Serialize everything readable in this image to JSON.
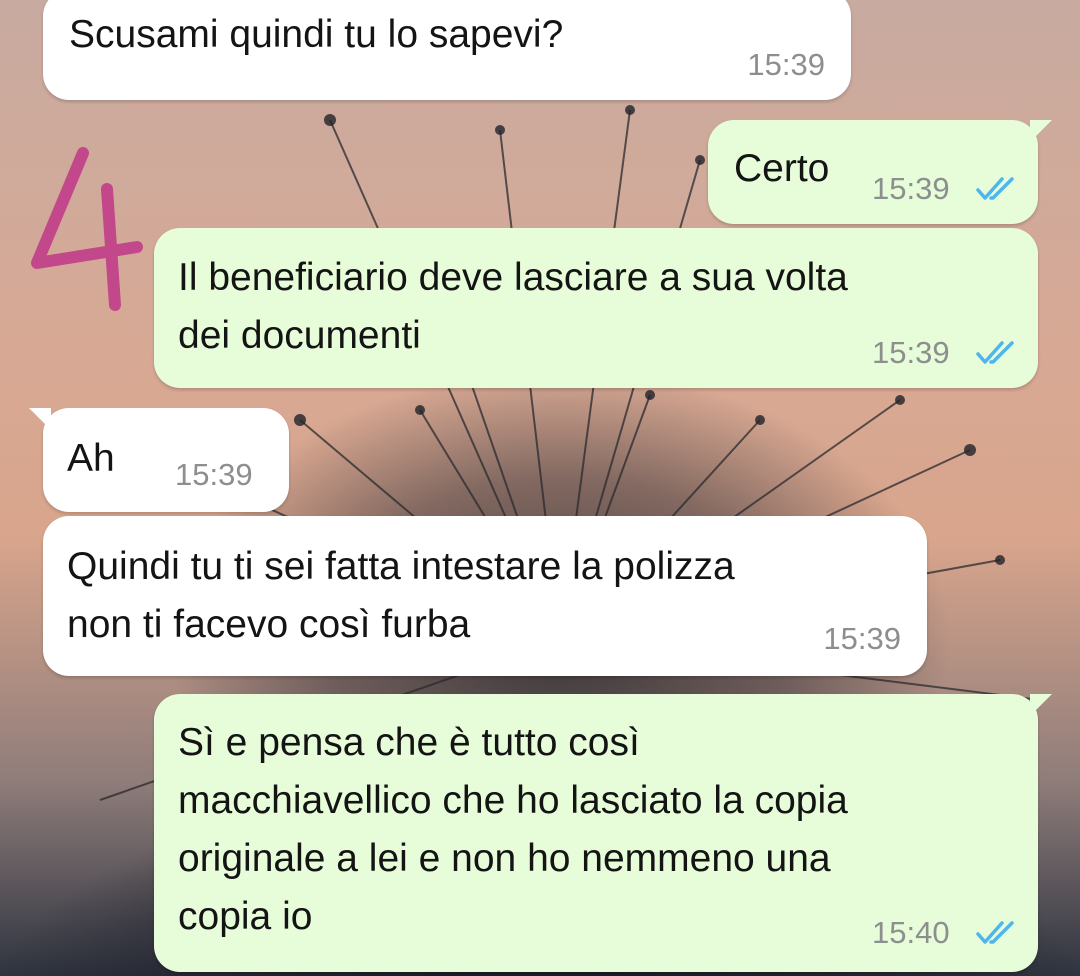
{
  "messages": [
    {
      "id": "m1",
      "direction": "incoming",
      "text": "Scusami quindi tu lo sapevi?",
      "time": "15:39"
    },
    {
      "id": "m2",
      "direction": "outgoing",
      "text": "Certo",
      "time": "15:39",
      "status": "read"
    },
    {
      "id": "m3",
      "direction": "outgoing",
      "text": "Il beneficiario deve lasciare a sua volta\ndei documenti",
      "time": "15:39",
      "status": "read"
    },
    {
      "id": "m4",
      "direction": "incoming",
      "text": "Ah",
      "time": "15:39"
    },
    {
      "id": "m5",
      "direction": "incoming",
      "text": "Quindi tu ti sei fatta intestare la polizza\nnon ti facevo così furba",
      "time": "15:39"
    },
    {
      "id": "m6",
      "direction": "outgoing",
      "text": "Sì e pensa che è tutto così\nmacchiavellico che ho lasciato la copia\noriginale a lei e non ho nemmeno una\ncopia io",
      "time": "15:40",
      "status": "read"
    }
  ],
  "annotation": {
    "text": "4",
    "color": "#c2478b"
  },
  "colors": {
    "incoming_bubble": "#ffffff",
    "outgoing_bubble": "#e7fcd9",
    "read_ticks": "#4fb6ec",
    "timestamp": "#8c8f8e"
  },
  "icons": {
    "read_receipt": "double-check-icon"
  }
}
